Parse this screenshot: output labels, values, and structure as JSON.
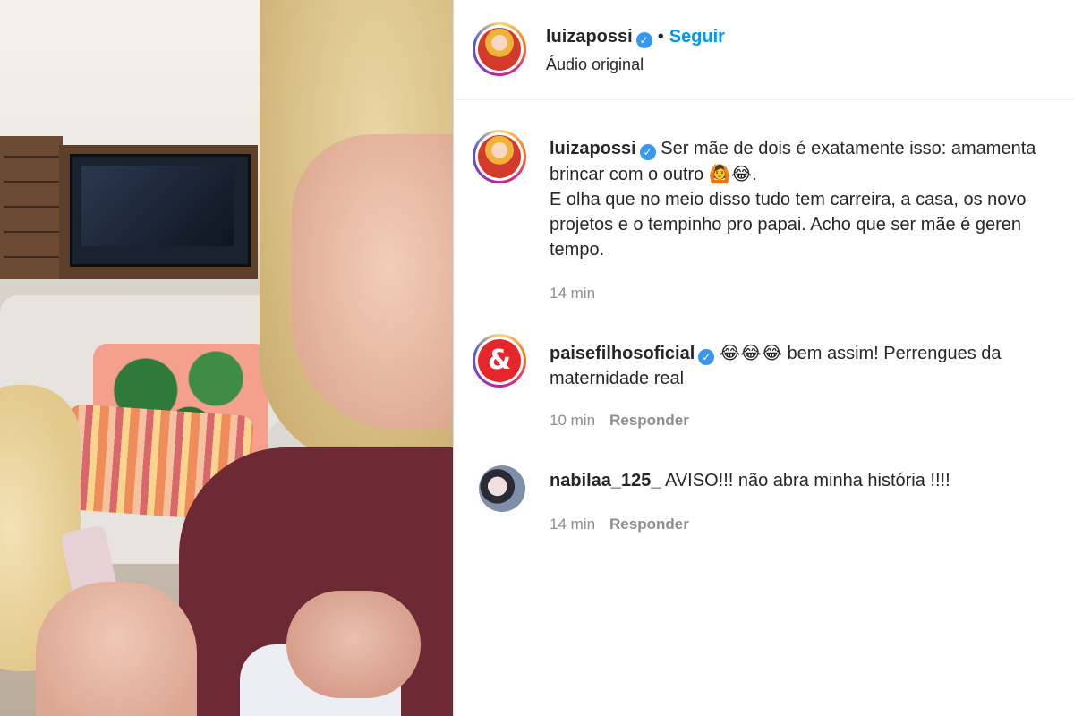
{
  "post": {
    "author": "luizapossi",
    "follow_label": "Seguir",
    "separator": "•",
    "audio": "Áudio original",
    "verified_icon": "✓"
  },
  "caption": {
    "author": "luizapossi",
    "line1": "Ser mãe de dois é exatamente isso: amamenta",
    "line2_text": "brincar com o outro ",
    "line2_emojis": "🙆😂",
    "line2_end": ".",
    "line3": "E olha que no meio disso tudo tem carreira, a casa, os novo",
    "line4": "projetos e o tempinho pro papai. Acho que ser mãe é geren",
    "line5": "tempo.",
    "time": "14 min"
  },
  "comments": [
    {
      "author": "paisefilhosoficial",
      "verified": true,
      "avatar_glyph": "&",
      "emojis": "😂😂😂",
      "text_a": " bem assim! Perrengues da",
      "text_b": "maternidade real",
      "time": "10 min",
      "reply_label": "Responder"
    },
    {
      "author": "nabilaa_125_",
      "verified": false,
      "text": "AVISO!!! não abra minha história !!!!",
      "time": "14 min",
      "reply_label": "Responder"
    }
  ],
  "colors": {
    "link_blue": "#0095f6",
    "verified_blue": "#3897f0",
    "muted": "#8e8e8e",
    "text": "#262626"
  }
}
